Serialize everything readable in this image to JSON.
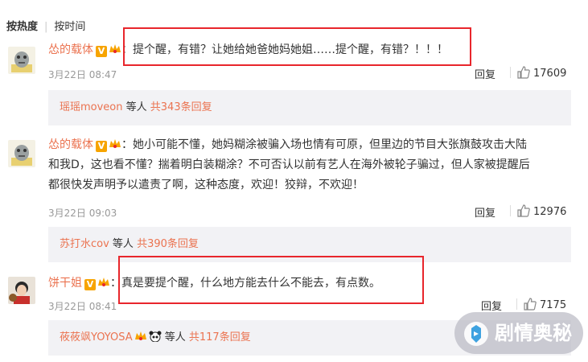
{
  "sort": {
    "hot": "按热度",
    "time": "按时间"
  },
  "comments": [
    {
      "user": "怂的载体",
      "badge_v": "V",
      "text": "：提个醒，有错？让她给她爸她妈她姐……提个醒，有错？！！！",
      "date": "3月22日 08:47",
      "reply": "回复",
      "likes": "17609",
      "sub_user": "瑶瑶moveon",
      "sub_mid": " 等人 ",
      "sub_count": "共343条回复"
    },
    {
      "user": "怂的载体",
      "badge_v": "V",
      "text_line1": "：她小可能不懂，她妈糊涂被骗入场也情有可原，但里边的节目大张旗鼓攻击大陆",
      "text_line2": "和我D，这也看不懂？揣着明白装糊涂？不可否认以前有艺人在海外被轮子骗过，但人家被提醒后",
      "text_line3": "都很快发声明予以遣责了啊，这种态度，欢迎！狡辩，不欢迎！",
      "date": "3月22日 09:03",
      "reply": "回复",
      "likes": "12976",
      "sub_user": "苏打水cov",
      "sub_mid": " 等人 ",
      "sub_count": "共390条回复"
    },
    {
      "user": "饼干姐",
      "badge_v": "V",
      "text": "：真是要提个醒，什么地方能去什么不能去，有点数。",
      "date": "3月22日 08:41",
      "reply": "回复",
      "likes": "7175",
      "sub_user": "莜莜飒YOYOSA",
      "sub_mid": " 等人 ",
      "sub_count": "共117条回复"
    }
  ],
  "watermark": {
    "text": "剧情奥秘"
  },
  "colors": {
    "accent": "#eb7350",
    "highlight_box": "#e8262c",
    "subreply_bg": "#f2f2f5"
  }
}
